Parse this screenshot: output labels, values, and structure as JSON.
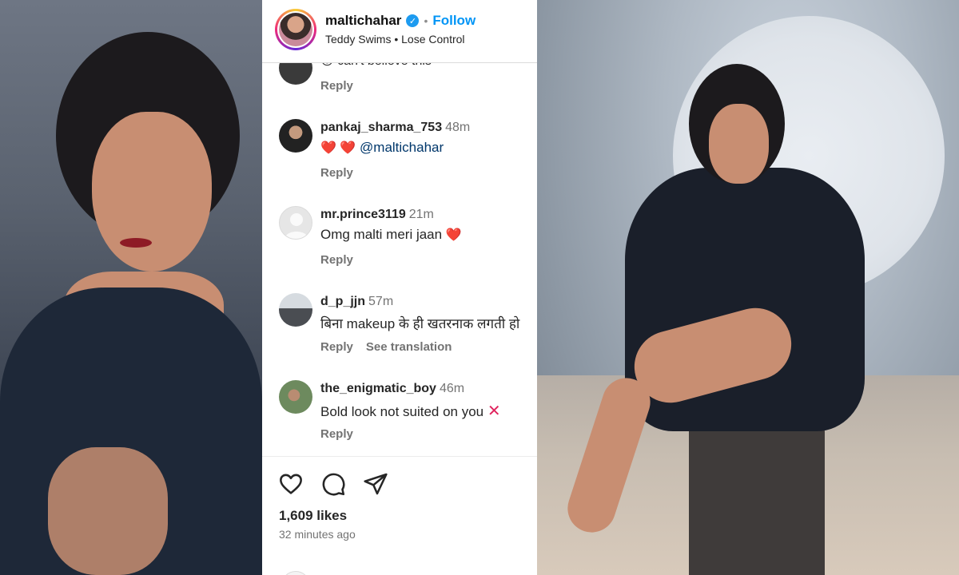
{
  "header": {
    "username": "maltichahar",
    "verified_icon": "✓",
    "separator": "•",
    "follow_label": "Follow",
    "music": "Teddy Swims • Lose Control"
  },
  "partial_comment": {
    "text": "😮 can't believe this",
    "reply_label": "Reply"
  },
  "comments": [
    {
      "username": "pankaj_sharma_753",
      "time": "48m",
      "emoji": "❤️ ❤️",
      "mention": "@maltichahar",
      "reply_label": "Reply"
    },
    {
      "username": "mr.prince3119",
      "time": "21m",
      "text": "Omg malti meri jaan",
      "emoji": "❤️",
      "reply_label": "Reply"
    },
    {
      "username": "d_p_jjn",
      "time": "57m",
      "text": "बिना makeup के ही खतरनाक लगती हो",
      "reply_label": "Reply",
      "translate_label": "See translation"
    },
    {
      "username": "the_enigmatic_boy",
      "time": "46m",
      "text": "Bold look not suited on you",
      "emoji": "✕",
      "reply_label": "Reply"
    }
  ],
  "actions": {
    "like_icon": "heart-icon",
    "comment_icon": "comment-icon",
    "share_icon": "send-icon",
    "likes": "1,609 likes",
    "time_ago": "32 minutes ago"
  },
  "colors": {
    "follow": "#0095f6",
    "verified": "#1d9bf0",
    "muted": "#737373",
    "mention": "#00376b"
  }
}
